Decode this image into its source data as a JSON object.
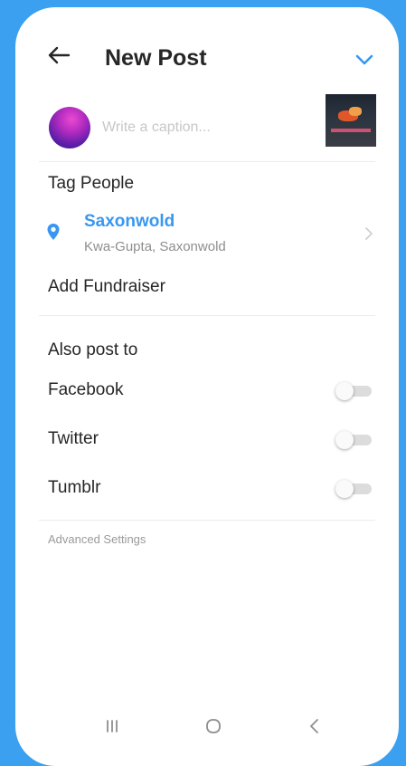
{
  "header": {
    "title": "New Post",
    "back_icon": "arrow-left-icon",
    "confirm_icon": "checkmark-icon",
    "accent_color": "#3897f0"
  },
  "caption": {
    "placeholder": "Write a caption...",
    "value": ""
  },
  "options": {
    "tag_people": "Tag People",
    "location": {
      "name": "Saxonwold",
      "subtitle": "Kwa-Gupta, Saxonwold"
    },
    "add_fundraiser": "Add Fundraiser"
  },
  "share": {
    "title": "Also post to",
    "targets": [
      {
        "label": "Facebook",
        "enabled": false
      },
      {
        "label": "Twitter",
        "enabled": false
      },
      {
        "label": "Tumblr",
        "enabled": false
      }
    ]
  },
  "advanced_settings": "Advanced Settings",
  "navbar": {
    "icons": [
      "recent-apps-icon",
      "home-icon",
      "back-icon"
    ]
  }
}
